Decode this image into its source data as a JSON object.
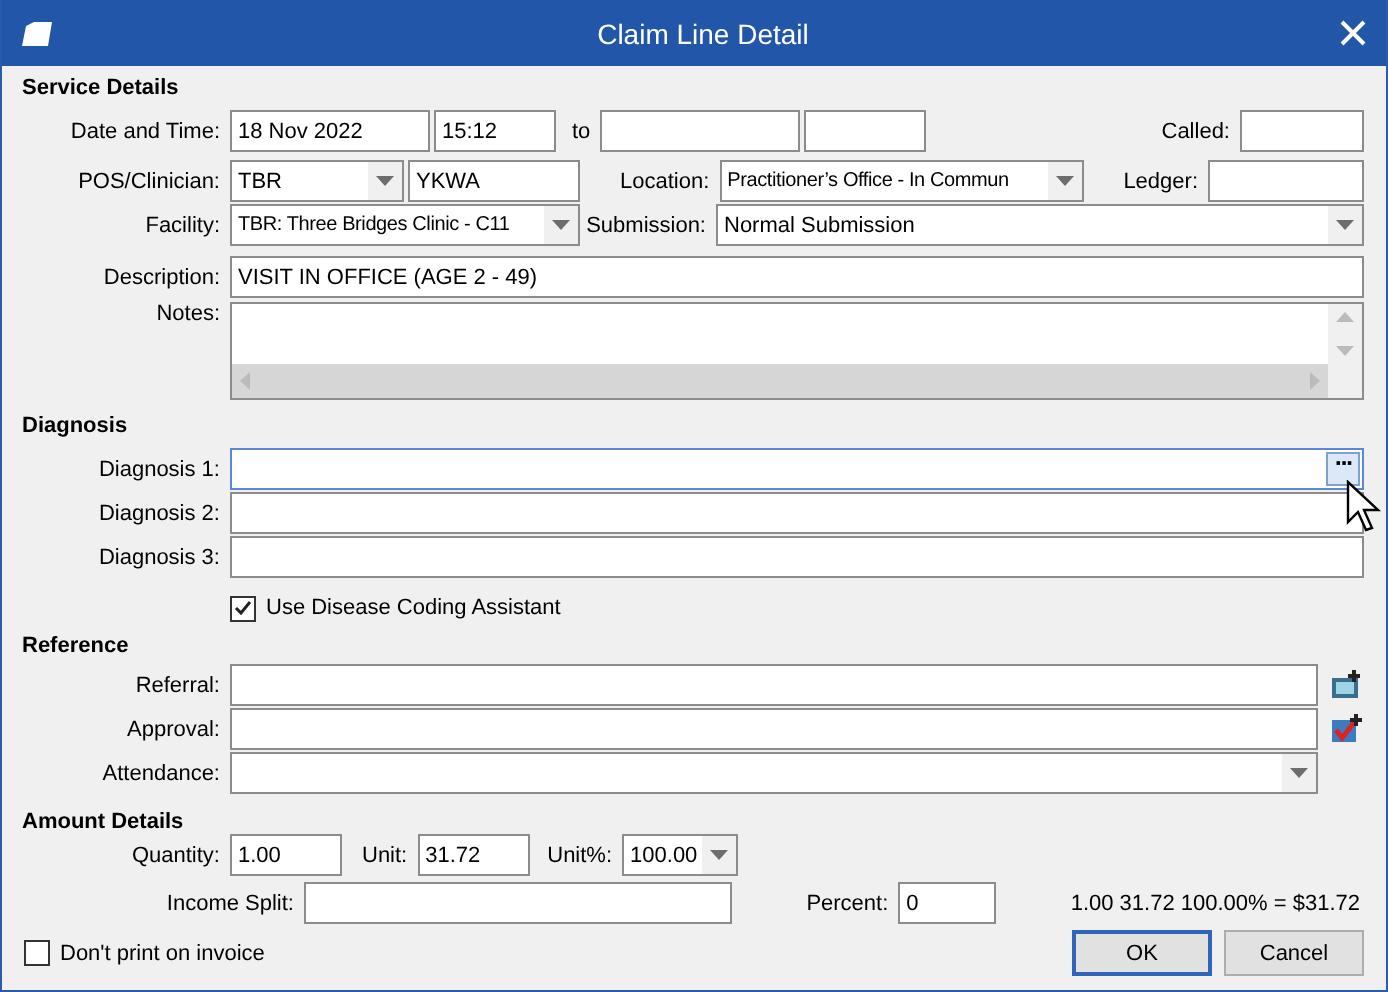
{
  "window": {
    "title": "Claim Line Detail"
  },
  "service_details": {
    "heading": "Service Details",
    "date_label": "Date and Time:",
    "date": "18 Nov 2022",
    "time": "15:12",
    "to_label": "to",
    "called_label": "Called:",
    "pos_label": "POS/Clinician:",
    "pos": "TBR",
    "clinician": "YKWA",
    "location_label": "Location:",
    "location": "Practitioner’s Office - In Commun",
    "ledger_label": "Ledger:",
    "facility_label": "Facility:",
    "facility": "TBR: Three Bridges Clinic - C11",
    "submission_label": "Submission:",
    "submission": "Normal Submission",
    "description_label": "Description:",
    "description": "VISIT IN OFFICE (AGE 2 - 49)",
    "notes_label": "Notes:"
  },
  "diagnosis": {
    "heading": "Diagnosis",
    "rows": [
      {
        "label": "Diagnosis 1:",
        "focused": true,
        "button": "···"
      },
      {
        "label": "Diagnosis 2:",
        "focused": false
      },
      {
        "label": "Diagnosis 3:",
        "focused": false
      }
    ],
    "coding_assistant": {
      "label": "Use Disease Coding Assistant",
      "checked": true
    }
  },
  "reference": {
    "heading": "Reference",
    "referral_label": "Referral:",
    "approval_label": "Approval:",
    "attendance_label": "Attendance:"
  },
  "amount": {
    "heading": "Amount Details",
    "quantity_label": "Quantity:",
    "quantity": "1.00",
    "unit_label": "Unit:",
    "unit": "31.72",
    "unit_pct_label": "Unit%:",
    "unit_pct": "100.00",
    "income_split_label": "Income Split:",
    "percent_label": "Percent:",
    "percent": "0",
    "summary": "1.00 31.72 100.00% = $31.72"
  },
  "dont_print": {
    "label": "Don't print on invoice",
    "checked": false
  },
  "buttons": [
    {
      "label": "OK",
      "default": true
    },
    {
      "label": "Cancel",
      "default": false
    }
  ]
}
